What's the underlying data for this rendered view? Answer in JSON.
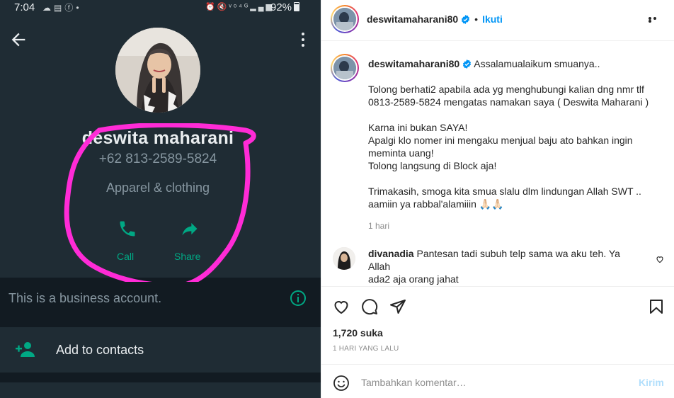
{
  "phone": {
    "status": {
      "time": "7:04",
      "battery": "92%",
      "left_icons": [
        "cloud-icon",
        "gallery-icon",
        "facebook-icon",
        "dot-icon"
      ],
      "right_icons": [
        "alarm-icon",
        "mute-icon",
        "volte-icon",
        "4g-icon",
        "signal-icon",
        "battery-icon"
      ]
    },
    "profile": {
      "name": "deswita maharani",
      "phone": "+62 813-2589-5824",
      "category": "Apparel & clothing",
      "call_label": "Call",
      "share_label": "Share"
    },
    "business_note": "This is a business account.",
    "add_contacts": "Add to contacts",
    "colors": {
      "highlight": "#ff2bd6",
      "accent": "#00a884",
      "background": "#121b22"
    }
  },
  "instagram": {
    "header": {
      "username": "deswitamaharani80",
      "verified": true,
      "follow_label": "Ikuti"
    },
    "caption": {
      "username": "deswitamaharani80",
      "lines": [
        "Assalamualaikum smuanya..",
        "",
        "Tolong berhati2 apabila ada yg menghubungi kalian dng nmr tlf",
        "0813-2589-5824 mengatas namakan saya ( Deswita Maharani )",
        "",
        "Karna ini bukan SAYA!",
        "Apalgi klo nomer ini mengaku menjual baju ato bahkan ingin",
        "meminta uang!",
        "Tolong langsung di Block aja!",
        "",
        "Trimakasih, smoga kita smua slalu dlm lindungan Allah SWT ..",
        "aamiin ya rabbal'alamiiin 🙏🏻🙏🏻"
      ],
      "time": "1 hari"
    },
    "comment": {
      "username": "divanadia",
      "text": "Pantesan tadi subuh telp sama wa aku teh. Ya Allah",
      "text2": "ada2 aja orang jahat"
    },
    "likes": "1,720 suka",
    "date": "1 HARI YANG LALU",
    "add_comment": {
      "placeholder": "Tambahkan komentar…",
      "post_label": "Kirim"
    },
    "colors": {
      "link": "#0095f6",
      "text": "#262626",
      "muted": "#8e8e8e",
      "post_disabled": "#b2dffc"
    }
  }
}
